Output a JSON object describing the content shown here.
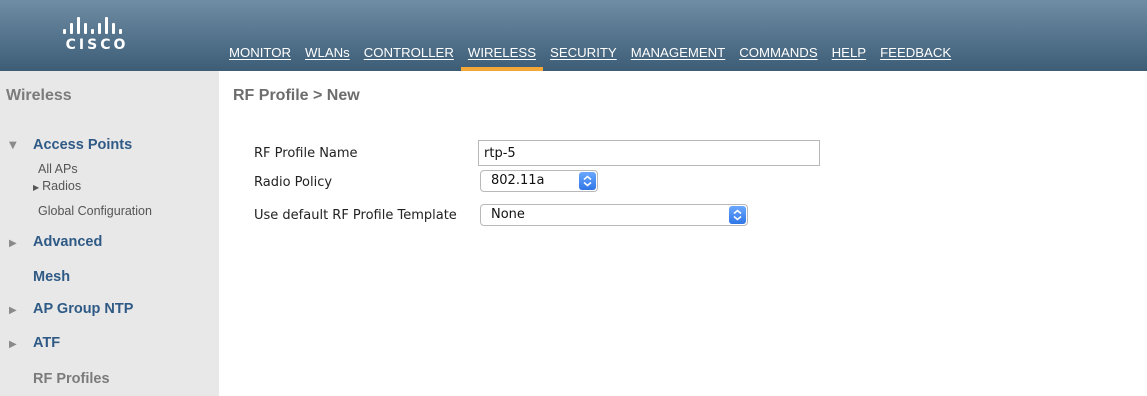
{
  "header": {
    "logo_text": "CISCO",
    "nav": [
      {
        "label": "MONITOR"
      },
      {
        "label": "WLANs"
      },
      {
        "label": "CONTROLLER"
      },
      {
        "label": "WIRELESS",
        "active": true
      },
      {
        "label": "SECURITY"
      },
      {
        "label": "MANAGEMENT"
      },
      {
        "label": "COMMANDS"
      },
      {
        "label": "HELP"
      },
      {
        "label": "FEEDBACK"
      }
    ],
    "active_color": "#f4a83a"
  },
  "sidebar": {
    "title": "Wireless",
    "access_points": {
      "label": "Access Points",
      "items": [
        "All APs",
        "Radios",
        "Global Configuration"
      ]
    },
    "advanced": "Advanced",
    "mesh": "Mesh",
    "ap_group_ntp": "AP Group NTP",
    "atf": "ATF",
    "rf_profiles": "RF Profiles"
  },
  "main": {
    "title": "RF Profile > New",
    "fields": {
      "name_label": "RF Profile Name",
      "name_value": "rtp-5",
      "radio_policy_label": "Radio Policy",
      "radio_policy_value": "802.11a",
      "template_label": "Use default RF Profile Template",
      "template_value": "None"
    }
  },
  "icons": {
    "expanded": "triangle-down-icon",
    "collapsed": "triangle-right-icon",
    "select": "select-chevron-icon"
  }
}
